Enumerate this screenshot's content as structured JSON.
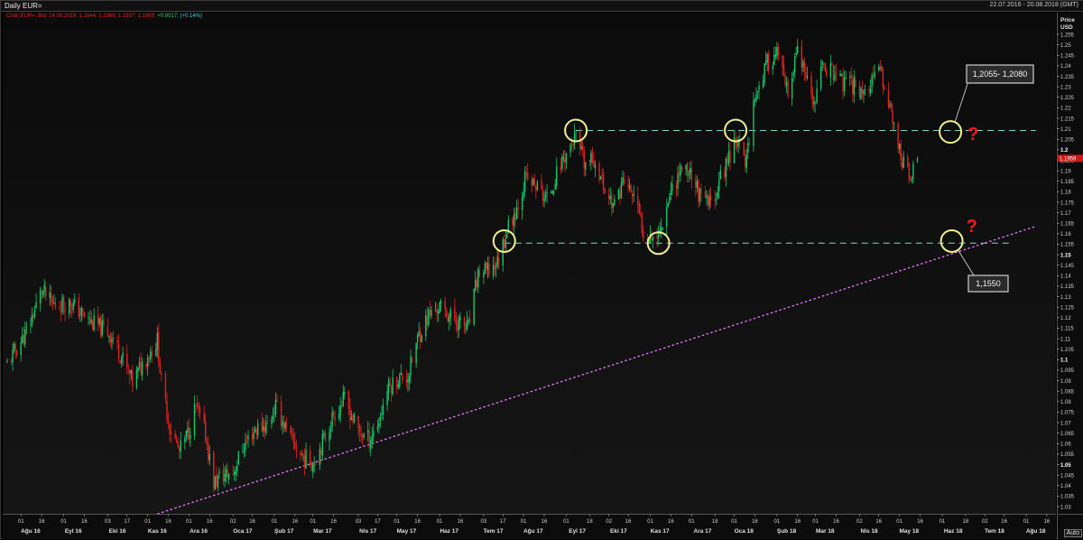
{
  "header": {
    "chart_title": "Daily EUR=",
    "date_range": "22.07.2016 - 20.08.2018 (GMT)",
    "quote_prefix": "Cndl; EUR=; Bid; 14.05.2018; 1.1944; 1.1968; 1.1937; 1.1959;",
    "quote_change": "+0.0017;",
    "quote_pct": "(+0.14%)"
  },
  "axis": {
    "price_title": "Price",
    "price_unit": "USD",
    "auto_label": "Auto",
    "last_price_label": "1.1959"
  },
  "annotations": {
    "upper_box": "1,2055- 1,2080",
    "lower_box": "1,1550",
    "question_mark": "?"
  },
  "colors": {
    "up_candle": "#19c86a",
    "down_candle": "#e02222",
    "level_line": "#7fd6c4",
    "trend_line": "#e678ff",
    "marker_circle": "#f0f08c",
    "question_mark": "#ff1a1a",
    "last_price_bg": "#d01818"
  },
  "chart_data": {
    "type": "candlestick",
    "title": "Daily EUR=",
    "ylabel": "Price USD",
    "ylim": [
      1.0265,
      1.2575
    ],
    "y_ticks": [
      1.03,
      1.035,
      1.04,
      1.045,
      1.05,
      1.055,
      1.06,
      1.065,
      1.07,
      1.075,
      1.08,
      1.085,
      1.09,
      1.095,
      1.1,
      1.105,
      1.11,
      1.115,
      1.12,
      1.125,
      1.13,
      1.135,
      1.14,
      1.145,
      1.15,
      1.155,
      1.16,
      1.165,
      1.17,
      1.175,
      1.18,
      1.185,
      1.19,
      1.195,
      1.2,
      1.205,
      1.21,
      1.215,
      1.22,
      1.225,
      1.23,
      1.235,
      1.24,
      1.245,
      1.25,
      1.255
    ],
    "major_y_ticks": [
      1.05,
      1.1,
      1.15,
      1.2
    ],
    "x_range": [
      "2016-07-22",
      "2018-08-20"
    ],
    "x_day_ticks": [
      {
        "date": "2016-08-01",
        "label": "01"
      },
      {
        "date": "2016-08-16",
        "label": "16"
      },
      {
        "date": "2016-09-01",
        "label": "01"
      },
      {
        "date": "2016-09-16",
        "label": "16"
      },
      {
        "date": "2016-10-03",
        "label": "03"
      },
      {
        "date": "2016-10-17",
        "label": "17"
      },
      {
        "date": "2016-11-01",
        "label": "01"
      },
      {
        "date": "2016-11-16",
        "label": "16"
      },
      {
        "date": "2016-12-01",
        "label": "01"
      },
      {
        "date": "2016-12-16",
        "label": "16"
      },
      {
        "date": "2017-01-02",
        "label": "02"
      },
      {
        "date": "2017-01-16",
        "label": "16"
      },
      {
        "date": "2017-02-01",
        "label": "01"
      },
      {
        "date": "2017-02-16",
        "label": "16"
      },
      {
        "date": "2017-03-01",
        "label": "01"
      },
      {
        "date": "2017-03-16",
        "label": "16"
      },
      {
        "date": "2017-04-03",
        "label": "03"
      },
      {
        "date": "2017-04-17",
        "label": "17"
      },
      {
        "date": "2017-05-01",
        "label": "01"
      },
      {
        "date": "2017-05-16",
        "label": "16"
      },
      {
        "date": "2017-06-01",
        "label": "01"
      },
      {
        "date": "2017-06-16",
        "label": "16"
      },
      {
        "date": "2017-07-03",
        "label": "03"
      },
      {
        "date": "2017-07-17",
        "label": "17"
      },
      {
        "date": "2017-08-01",
        "label": "01"
      },
      {
        "date": "2017-08-16",
        "label": "16"
      },
      {
        "date": "2017-09-01",
        "label": "01"
      },
      {
        "date": "2017-09-18",
        "label": "18"
      },
      {
        "date": "2017-10-02",
        "label": "02"
      },
      {
        "date": "2017-10-16",
        "label": "16"
      },
      {
        "date": "2017-11-01",
        "label": "01"
      },
      {
        "date": "2017-11-16",
        "label": "16"
      },
      {
        "date": "2017-12-01",
        "label": "01"
      },
      {
        "date": "2017-12-18",
        "label": "18"
      },
      {
        "date": "2018-01-01",
        "label": "01"
      },
      {
        "date": "2018-01-16",
        "label": "16"
      },
      {
        "date": "2018-02-01",
        "label": "01"
      },
      {
        "date": "2018-02-16",
        "label": "16"
      },
      {
        "date": "2018-03-01",
        "label": "01"
      },
      {
        "date": "2018-03-16",
        "label": "16"
      },
      {
        "date": "2018-04-02",
        "label": "02"
      },
      {
        "date": "2018-04-16",
        "label": "16"
      },
      {
        "date": "2018-05-01",
        "label": "01"
      },
      {
        "date": "2018-05-16",
        "label": "16"
      },
      {
        "date": "2018-06-01",
        "label": "01"
      },
      {
        "date": "2018-06-18",
        "label": "18"
      },
      {
        "date": "2018-07-02",
        "label": "02"
      },
      {
        "date": "2018-07-16",
        "label": "16"
      },
      {
        "date": "2018-08-01",
        "label": "01"
      },
      {
        "date": "2018-08-16",
        "label": "16"
      }
    ],
    "x_month_ticks": [
      {
        "date": "2016-08-08",
        "label": "Ağu 16"
      },
      {
        "date": "2016-09-08",
        "label": "Eyl 16"
      },
      {
        "date": "2016-10-10",
        "label": "Eki 16"
      },
      {
        "date": "2016-11-08",
        "label": "Kas 16"
      },
      {
        "date": "2016-12-08",
        "label": "Ara 16"
      },
      {
        "date": "2017-01-09",
        "label": "Oca 17"
      },
      {
        "date": "2017-02-08",
        "label": "Şub 17"
      },
      {
        "date": "2017-03-08",
        "label": "Mar 17"
      },
      {
        "date": "2017-04-10",
        "label": "Nis 17"
      },
      {
        "date": "2017-05-08",
        "label": "May 17"
      },
      {
        "date": "2017-06-08",
        "label": "Haz 17"
      },
      {
        "date": "2017-07-10",
        "label": "Tem 17"
      },
      {
        "date": "2017-08-08",
        "label": "Ağu 17"
      },
      {
        "date": "2017-09-09",
        "label": "Eyl 17"
      },
      {
        "date": "2017-10-09",
        "label": "Eki 17"
      },
      {
        "date": "2017-11-08",
        "label": "Kas 17"
      },
      {
        "date": "2017-12-09",
        "label": "Ara 17"
      },
      {
        "date": "2018-01-08",
        "label": "Oca 18"
      },
      {
        "date": "2018-02-08",
        "label": "Şub 18"
      },
      {
        "date": "2018-03-08",
        "label": "Mar 18"
      },
      {
        "date": "2018-04-09",
        "label": "Nis 18"
      },
      {
        "date": "2018-05-08",
        "label": "May 18"
      },
      {
        "date": "2018-06-09",
        "label": "Haz 18"
      },
      {
        "date": "2018-07-09",
        "label": "Tem 18"
      },
      {
        "date": "2018-08-08",
        "label": "Ağu 18"
      }
    ],
    "last_candle": {
      "date": "2018-05-14",
      "open": 1.1944,
      "high": 1.1968,
      "low": 1.1937,
      "close": 1.1959
    },
    "approx_close_path": [
      [
        "2016-07-22",
        1.098
      ],
      [
        "2016-08-05",
        1.113
      ],
      [
        "2016-08-16",
        1.133
      ],
      [
        "2016-08-24",
        1.126
      ],
      [
        "2016-09-06",
        1.127
      ],
      [
        "2016-09-20",
        1.118
      ],
      [
        "2016-10-04",
        1.113
      ],
      [
        "2016-10-12",
        1.103
      ],
      [
        "2016-10-21",
        1.089
      ],
      [
        "2016-10-28",
        1.098
      ],
      [
        "2016-11-08",
        1.109
      ],
      [
        "2016-11-11",
        1.089
      ],
      [
        "2016-11-17",
        1.068
      ],
      [
        "2016-11-24",
        1.056
      ],
      [
        "2016-12-01",
        1.066
      ],
      [
        "2016-12-06",
        1.078
      ],
      [
        "2016-12-13",
        1.064
      ],
      [
        "2016-12-19",
        1.041
      ],
      [
        "2016-12-23",
        1.044
      ],
      [
        "2017-01-02",
        1.046
      ],
      [
        "2017-01-09",
        1.058
      ],
      [
        "2017-01-18",
        1.067
      ],
      [
        "2017-01-27",
        1.069
      ],
      [
        "2017-02-02",
        1.078
      ],
      [
        "2017-02-13",
        1.062
      ],
      [
        "2017-02-22",
        1.053
      ],
      [
        "2017-03-01",
        1.051
      ],
      [
        "2017-03-09",
        1.062
      ],
      [
        "2017-03-16",
        1.074
      ],
      [
        "2017-03-24",
        1.081
      ],
      [
        "2017-04-03",
        1.066
      ],
      [
        "2017-04-11",
        1.062
      ],
      [
        "2017-04-18",
        1.071
      ],
      [
        "2017-04-24",
        1.086
      ],
      [
        "2017-05-02",
        1.091
      ],
      [
        "2017-05-09",
        1.092
      ],
      [
        "2017-05-17",
        1.112
      ],
      [
        "2017-05-24",
        1.121
      ],
      [
        "2017-06-01",
        1.125
      ],
      [
        "2017-06-08",
        1.121
      ],
      [
        "2017-06-16",
        1.117
      ],
      [
        "2017-06-22",
        1.115
      ],
      [
        "2017-06-29",
        1.141
      ],
      [
        "2017-07-06",
        1.142
      ],
      [
        "2017-07-13",
        1.146
      ],
      [
        "2017-07-20",
        1.162
      ],
      [
        "2017-07-27",
        1.172
      ],
      [
        "2017-08-02",
        1.186
      ],
      [
        "2017-08-11",
        1.182
      ],
      [
        "2017-08-18",
        1.176
      ],
      [
        "2017-08-29",
        1.195
      ],
      [
        "2017-09-08",
        1.206
      ],
      [
        "2017-09-14",
        1.193
      ],
      [
        "2017-09-22",
        1.195
      ],
      [
        "2017-09-29",
        1.181
      ],
      [
        "2017-10-06",
        1.173
      ],
      [
        "2017-10-12",
        1.185
      ],
      [
        "2017-10-20",
        1.178
      ],
      [
        "2017-10-27",
        1.161
      ],
      [
        "2017-11-07",
        1.159
      ],
      [
        "2017-11-15",
        1.179
      ],
      [
        "2017-11-24",
        1.192
      ],
      [
        "2017-12-01",
        1.189
      ],
      [
        "2017-12-08",
        1.176
      ],
      [
        "2017-12-15",
        1.174
      ],
      [
        "2017-12-22",
        1.186
      ],
      [
        "2018-01-02",
        1.206
      ],
      [
        "2018-01-09",
        1.193
      ],
      [
        "2018-01-16",
        1.226
      ],
      [
        "2018-01-25",
        1.241
      ],
      [
        "2018-02-01",
        1.246
      ],
      [
        "2018-02-09",
        1.225
      ],
      [
        "2018-02-16",
        1.248
      ],
      [
        "2018-02-27",
        1.221
      ],
      [
        "2018-03-07",
        1.241
      ],
      [
        "2018-03-15",
        1.236
      ],
      [
        "2018-03-22",
        1.231
      ],
      [
        "2018-03-29",
        1.231
      ],
      [
        "2018-04-06",
        1.227
      ],
      [
        "2018-04-17",
        1.238
      ],
      [
        "2018-04-24",
        1.221
      ],
      [
        "2018-05-01",
        1.199
      ],
      [
        "2018-05-09",
        1.186
      ],
      [
        "2018-05-14",
        1.1959
      ]
    ],
    "levels": [
      {
        "price": 1.2092,
        "from": "2017-09-08",
        "to": "2018-08-08"
      },
      {
        "price": 1.1555,
        "from": "2017-07-18",
        "to": "2018-07-20"
      }
    ],
    "trendline": {
      "from": [
        "2016-11-08",
        1.0265
      ],
      "to": [
        "2018-08-08",
        1.1635
      ]
    },
    "circled_points": [
      [
        "2017-07-18",
        1.1565
      ],
      [
        "2017-09-08",
        1.2092
      ],
      [
        "2017-11-07",
        1.1555
      ],
      [
        "2018-01-02",
        1.2092
      ],
      [
        "2018-06-07",
        1.2085
      ],
      [
        "2018-06-08",
        1.1565
      ]
    ]
  }
}
